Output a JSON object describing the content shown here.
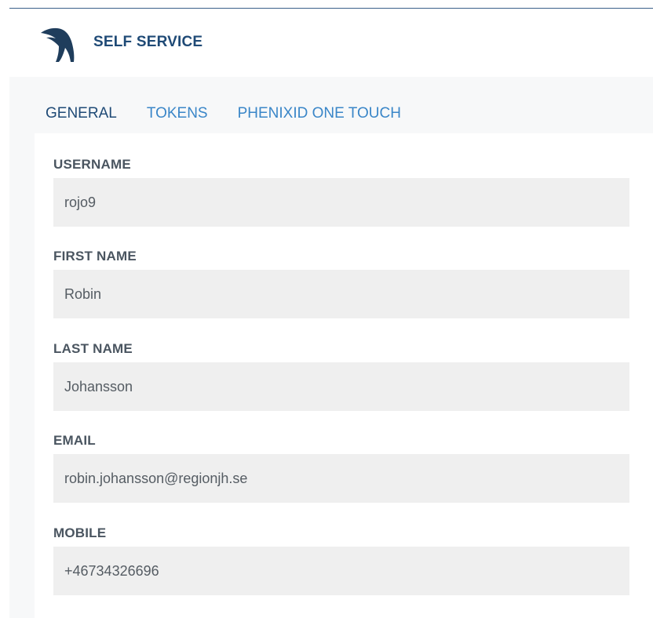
{
  "header": {
    "app_title": "SELF SERVICE",
    "logo_icon": "bird-logo-icon",
    "brand_color": "#1f4a76"
  },
  "tabs": [
    {
      "label": "GENERAL",
      "active": true
    },
    {
      "label": "TOKENS",
      "active": false
    },
    {
      "label": "PHENIXID ONE TOUCH",
      "active": false
    }
  ],
  "form": {
    "username": {
      "label": "USERNAME",
      "value": "rojo9"
    },
    "first_name": {
      "label": "FIRST NAME",
      "value": "Robin"
    },
    "last_name": {
      "label": "LAST NAME",
      "value": "Johansson"
    },
    "email": {
      "label": "EMAIL",
      "value": "robin.johansson@regionjh.se"
    },
    "mobile": {
      "label": "MOBILE",
      "value": "+46734326696"
    }
  },
  "colors": {
    "tab_active": "#1f4a76",
    "tab_inactive": "#3a86c8",
    "input_background": "#efefef"
  }
}
